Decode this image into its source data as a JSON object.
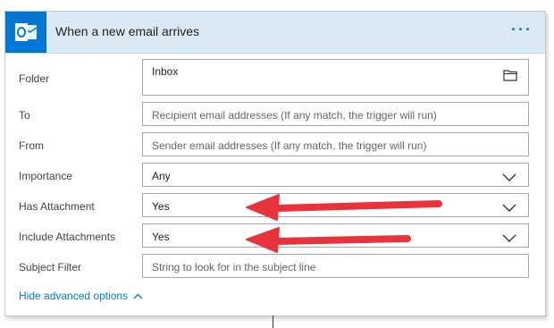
{
  "header": {
    "title": "When a new email arrives",
    "more_label": "···",
    "app_icon": "outlook-icon",
    "accent_color": "#0078d4",
    "header_bg": "#dbe9f4"
  },
  "fields": {
    "folder": {
      "label": "Folder",
      "value": "Inbox",
      "icon": "folder-icon"
    },
    "to": {
      "label": "To",
      "placeholder": "Recipient email addresses (If any match, the trigger will run)"
    },
    "from": {
      "label": "From",
      "placeholder": "Sender email addresses (If any match, the trigger will run)"
    },
    "importance": {
      "label": "Importance",
      "value": "Any"
    },
    "has_attachment": {
      "label": "Has Attachment",
      "value": "Yes"
    },
    "include_attachments": {
      "label": "Include Attachments",
      "value": "Yes"
    },
    "subject_filter": {
      "label": "Subject Filter",
      "placeholder": "String to look for in the subject line"
    }
  },
  "footer": {
    "hide_advanced_label": "Hide advanced options"
  },
  "annotation_color": "#e8333c"
}
